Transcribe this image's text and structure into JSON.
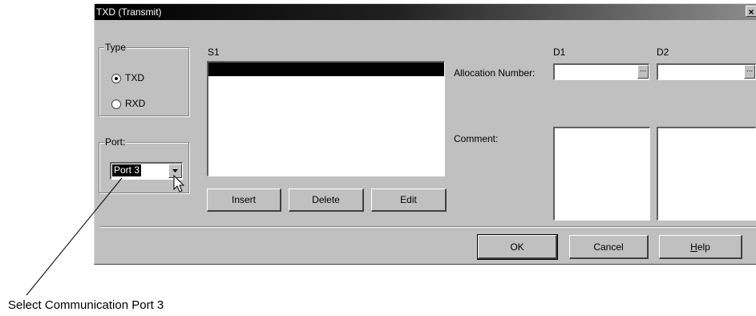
{
  "window": {
    "title": "TXD (Transmit)",
    "close_glyph": "×"
  },
  "type_group": {
    "label": "Type",
    "options": [
      {
        "label": "TXD",
        "selected": true
      },
      {
        "label": "RXD",
        "selected": false
      }
    ]
  },
  "port_group": {
    "label": "Port:",
    "selected_value": "Port 3"
  },
  "s1": {
    "label": "S1",
    "buttons": {
      "insert": "Insert",
      "delete": "Delete",
      "edit": "Edit"
    }
  },
  "columns": {
    "d1": "D1",
    "d2": "D2"
  },
  "allocation": {
    "label": "Allocation Number:",
    "browse_glyph": "..."
  },
  "comment": {
    "label": "Comment:"
  },
  "footer_buttons": {
    "ok": "OK",
    "cancel": "Cancel",
    "help": "Help"
  },
  "annotation": {
    "caption": "Select Communication Port 3"
  },
  "icons": {
    "dropdown": "chevron-down-icon",
    "cursor": "mouse-pointer-icon",
    "close": "close-icon"
  }
}
